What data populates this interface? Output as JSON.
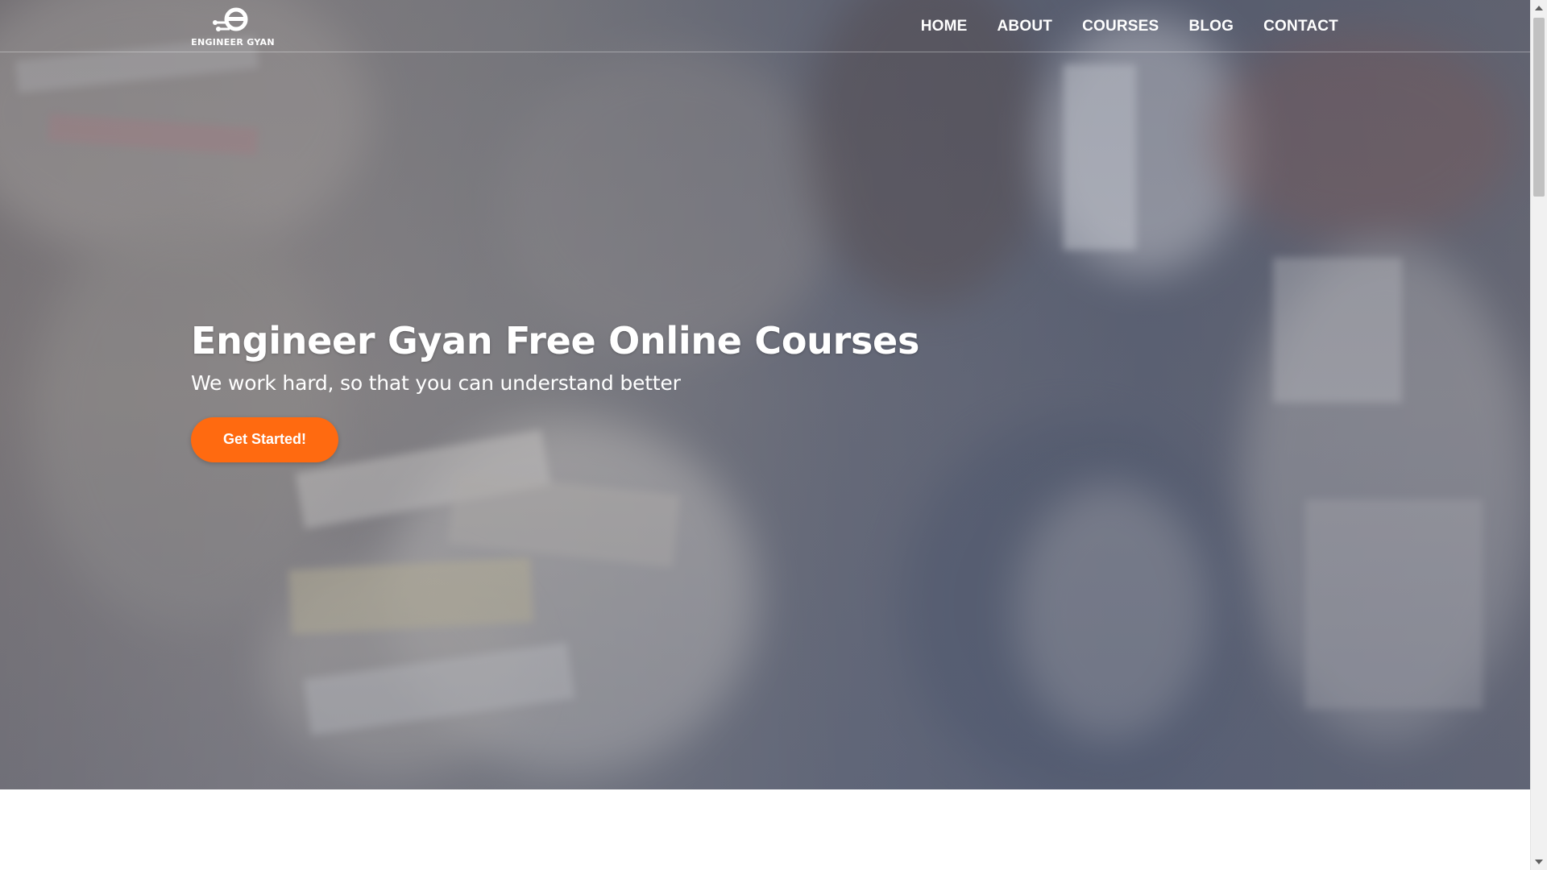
{
  "brand": {
    "name": "ENGINEER GYAN",
    "logo_icon": "engineer-gyan-logo-icon"
  },
  "nav": {
    "items": [
      {
        "label": "HOME"
      },
      {
        "label": "ABOUT"
      },
      {
        "label": "COURSES"
      },
      {
        "label": "BLOG"
      },
      {
        "label": "CONTACT"
      }
    ]
  },
  "hero": {
    "title": "Engineer Gyan Free Online Courses",
    "subtitle": "We work hard, so that you can understand better",
    "cta_label": "Get Started!",
    "background": "blurred-library-books-photo"
  },
  "colors": {
    "accent": "#ff6a10",
    "text_on_hero": "#ffffff",
    "page_background": "#ffffff"
  }
}
